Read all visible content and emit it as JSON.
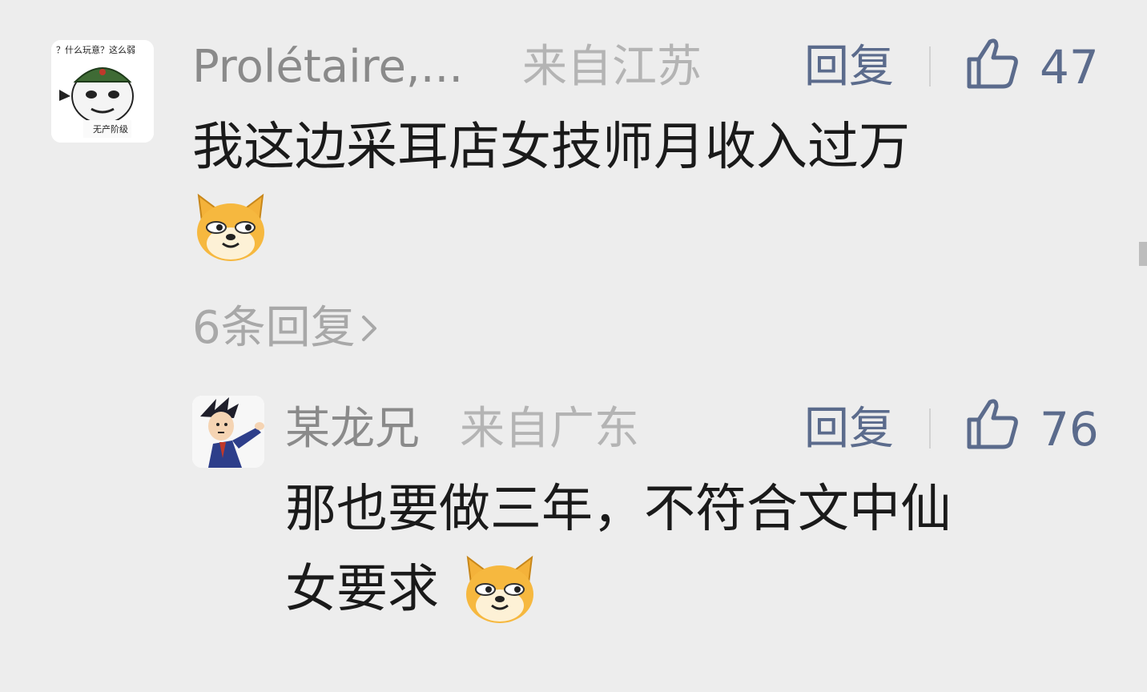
{
  "comments": [
    {
      "user": "Prolétaire,...",
      "region": "来自江苏",
      "reply_label": "回复",
      "likes": "47",
      "avatar_text_top": "？什么玩意？这么弱",
      "avatar_text_bottom": "无产阶级",
      "text_line1": "我这边采耳店女技师月收入过万",
      "more_replies": "6条回复",
      "more_icon": "chevron-right-icon"
    },
    {
      "user": "某龙兄",
      "region": "来自广东",
      "reply_label": "回复",
      "likes": "76",
      "text_line1": "那也要做三年，不符合文中仙",
      "text_line2": "女要求"
    }
  ],
  "icons": {
    "like": "thumbs-up-icon",
    "emoji": "doge-emoji-icon"
  },
  "colors": {
    "background": "#ededed",
    "name": "#8a8a8a",
    "region": "#b4b4b4",
    "accent": "#5b6b8c",
    "text": "#1a1a1a"
  }
}
